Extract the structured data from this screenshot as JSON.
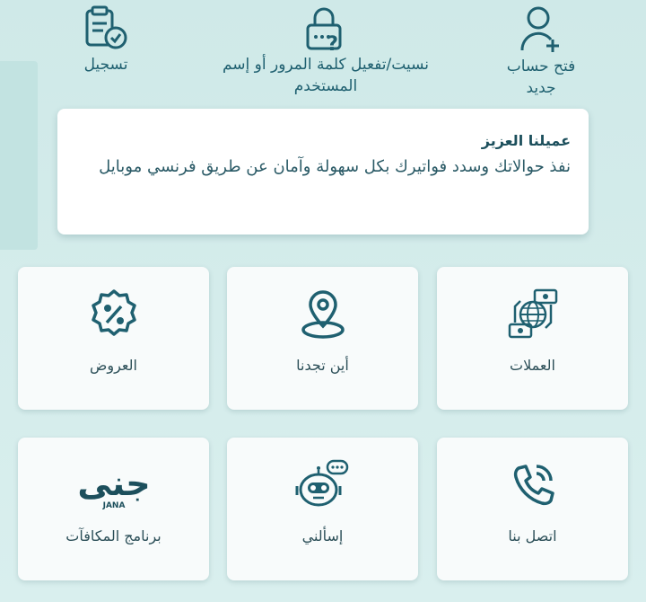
{
  "top_actions": {
    "open_account": "فتح حساب جديد",
    "forgot": "نسيت/تفعيل كلمة المرور أو إسم المستخدم",
    "register": "تسجيل"
  },
  "welcome": {
    "title": "عميلنا العزيز",
    "body": "نفذ حوالاتك وسدد فواتيرك بكل سهولة وآمان عن طريق فرنسي موبايل"
  },
  "tiles": [
    {
      "label": "العملات",
      "icon": "currency-globe-icon"
    },
    {
      "label": "أين تجدنا",
      "icon": "location-pin-icon"
    },
    {
      "label": "العروض",
      "icon": "percent-badge-icon"
    },
    {
      "label": "اتصل بنا",
      "icon": "phone-icon"
    },
    {
      "label": "إسألني",
      "icon": "chatbot-icon"
    },
    {
      "label": "برنامج المكافآت",
      "icon": "jana-logo"
    }
  ],
  "jana_logo": {
    "text": "جنى",
    "latin": "JANA"
  },
  "colors": {
    "accent": "#1f6070",
    "background": "#d2ebea",
    "card": "#ffffff"
  }
}
